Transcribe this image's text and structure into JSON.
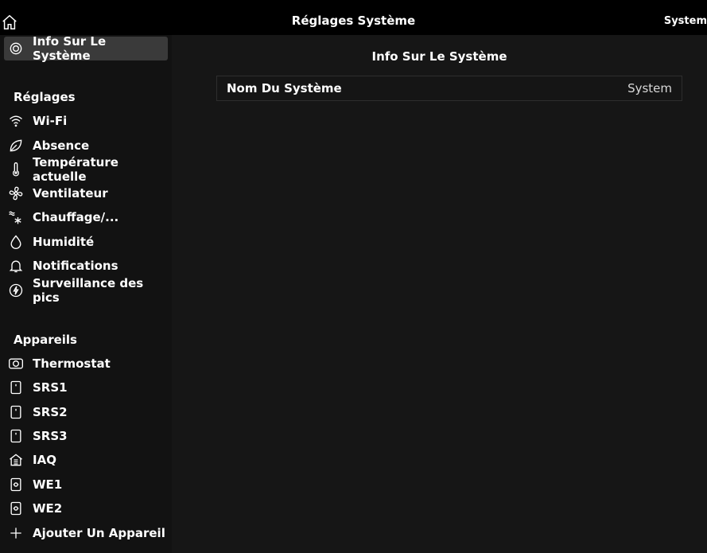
{
  "header": {
    "title": "Réglages Système",
    "system_name": "System"
  },
  "sidebar": {
    "top_item": {
      "label": "Info Sur Le Système",
      "icon": "info-circle-icon",
      "selected": true
    },
    "settings_title": "Réglages",
    "settings": [
      {
        "label": "Wi-Fi",
        "icon": "wifi-icon"
      },
      {
        "label": "Absence",
        "icon": "leaf-icon"
      },
      {
        "label": "Température actuelle",
        "icon": "thermometer-icon"
      },
      {
        "label": "Ventilateur",
        "icon": "fan-icon"
      },
      {
        "label": "Chauffage/...",
        "icon": "heat-cool-icon"
      },
      {
        "label": "Humidité",
        "icon": "droplet-icon"
      },
      {
        "label": "Notifications",
        "icon": "bell-icon"
      },
      {
        "label": "Surveillance des pics",
        "icon": "lightning-circle-icon"
      }
    ],
    "devices_title": "Appareils",
    "devices": [
      {
        "label": "Thermostat",
        "icon": "thermostat-icon"
      },
      {
        "label": "SRS1",
        "icon": "sensor-icon"
      },
      {
        "label": "SRS2",
        "icon": "sensor-icon"
      },
      {
        "label": "SRS3",
        "icon": "sensor-icon"
      },
      {
        "label": "IAQ",
        "icon": "house-filter-icon"
      },
      {
        "label": "WE1",
        "icon": "controller-icon"
      },
      {
        "label": "WE2",
        "icon": "controller-icon"
      },
      {
        "label": "Ajouter Un Appareil",
        "icon": "plus-icon"
      }
    ]
  },
  "main": {
    "title": "Info Sur Le Système",
    "rows": [
      {
        "label": "Nom Du Système",
        "value": "System"
      }
    ]
  }
}
